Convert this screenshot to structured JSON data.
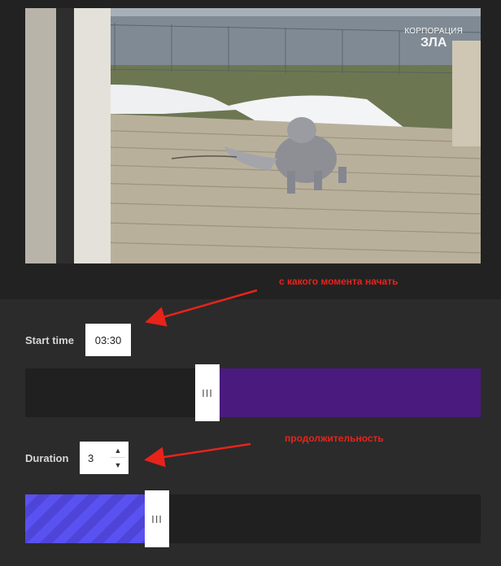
{
  "video": {
    "watermark_line1": "КОРПОРАЦИЯ",
    "watermark_line2": "ЗЛА"
  },
  "annotations": {
    "start_hint": "с какого момента начать",
    "duration_hint": "продолжительность"
  },
  "start_time": {
    "label": "Start time",
    "value": "03:30",
    "slider_position_fraction": 0.43
  },
  "duration": {
    "label": "Duration",
    "value": "3",
    "up_icon": "triangle-up-icon",
    "down_icon": "triangle-down-icon",
    "slider_position_fraction": 0.29
  },
  "handle_glyph": "III",
  "colors": {
    "background": "#2b2b2b",
    "track": "#202020",
    "selected_range": "#4b1a7e",
    "duration_fill": "#5a51f1",
    "annotation": "#e8231b"
  }
}
